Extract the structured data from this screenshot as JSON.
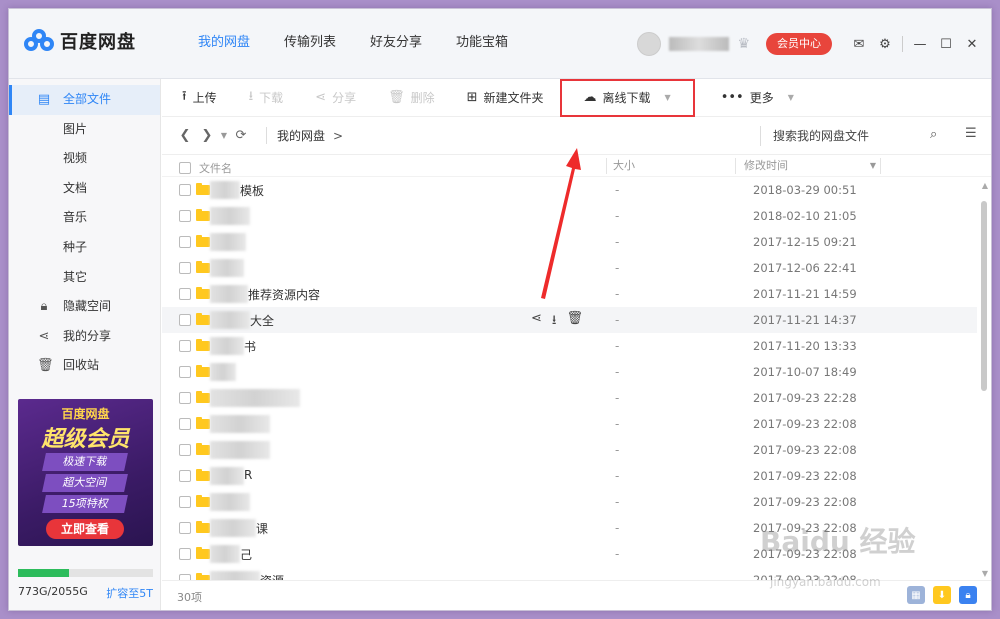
{
  "app": {
    "logo_text": "百度网盘",
    "nav": [
      "我的网盘",
      "传输列表",
      "好友分享",
      "功能宝箱"
    ],
    "vip_label": "会员中心",
    "controls": {
      "mail": "✉",
      "settings": "⚙",
      "minimize": "—",
      "maximize": "☐",
      "close": "✕"
    }
  },
  "sidebar": {
    "items": [
      {
        "label": "全部文件",
        "icon": "document-icon"
      },
      {
        "label": "图片"
      },
      {
        "label": "视频"
      },
      {
        "label": "文档"
      },
      {
        "label": "音乐"
      },
      {
        "label": "种子"
      },
      {
        "label": "其它"
      },
      {
        "label": "隐藏空间",
        "icon": "lock-icon"
      },
      {
        "label": "我的分享",
        "icon": "share-icon"
      },
      {
        "label": "回收站",
        "icon": "trash-icon"
      }
    ],
    "ad": {
      "t1": "百度网盘",
      "t2": "超级会员",
      "lines": [
        "极速下载",
        "超大空间",
        "15项特权"
      ],
      "button": "立即查看"
    },
    "storage": {
      "used": "773G/2055G",
      "expand": "扩容至5T",
      "fraction": 0.376
    }
  },
  "toolbar": {
    "upload": "上传",
    "download": "下载",
    "share": "分享",
    "delete": "删除",
    "new_folder": "新建文件夹",
    "offline_download": "离线下载",
    "more": "更多"
  },
  "path": {
    "crumb": "我的网盘",
    "crumb_sep": ">",
    "search_placeholder": "搜索我的网盘文件"
  },
  "table": {
    "col_name": "文件名",
    "col_size": "大小",
    "col_mtime": "修改时间",
    "rows": [
      {
        "name": "模板",
        "size": "-",
        "date": "2018-03-29 00:51"
      },
      {
        "name": "",
        "size": "-",
        "date": "2018-02-10 21:05"
      },
      {
        "name": "",
        "size": "-",
        "date": "2017-12-15 09:21"
      },
      {
        "name": "",
        "size": "-",
        "date": "2017-12-06 22:41"
      },
      {
        "name": "推荐资源内容",
        "size": "-",
        "date": "2017-11-21 14:59"
      },
      {
        "name": "大全",
        "size": "-",
        "date": "2017-11-21 14:37"
      },
      {
        "name": "书",
        "size": "-",
        "date": "2017-11-20 13:33"
      },
      {
        "name": "",
        "size": "-",
        "date": "2017-10-07 18:49"
      },
      {
        "name": "",
        "size": "-",
        "date": "2017-09-23 22:28"
      },
      {
        "name": "",
        "size": "-",
        "date": "2017-09-23 22:08"
      },
      {
        "name": "",
        "size": "-",
        "date": "2017-09-23 22:08"
      },
      {
        "name": "R",
        "size": "-",
        "date": "2017-09-23 22:08"
      },
      {
        "name": "",
        "size": "-",
        "date": "2017-09-23 22:08"
      },
      {
        "name": "课",
        "size": "-",
        "date": "2017-09-23 22:08"
      },
      {
        "name": "己",
        "size": "-",
        "date": "2017-09-23 22:08"
      },
      {
        "name": "资源",
        "size": "-",
        "date": "2017-09-23 22:08"
      }
    ]
  },
  "footer": {
    "count": "30项"
  },
  "watermark": {
    "main": "Baidu 经验",
    "sub": "jingyan.baidu.com"
  },
  "colors": {
    "accent": "#2f86f6",
    "highlight_box": "#e8353a",
    "vip": "#e8453c",
    "folder": "#ffc81f"
  }
}
